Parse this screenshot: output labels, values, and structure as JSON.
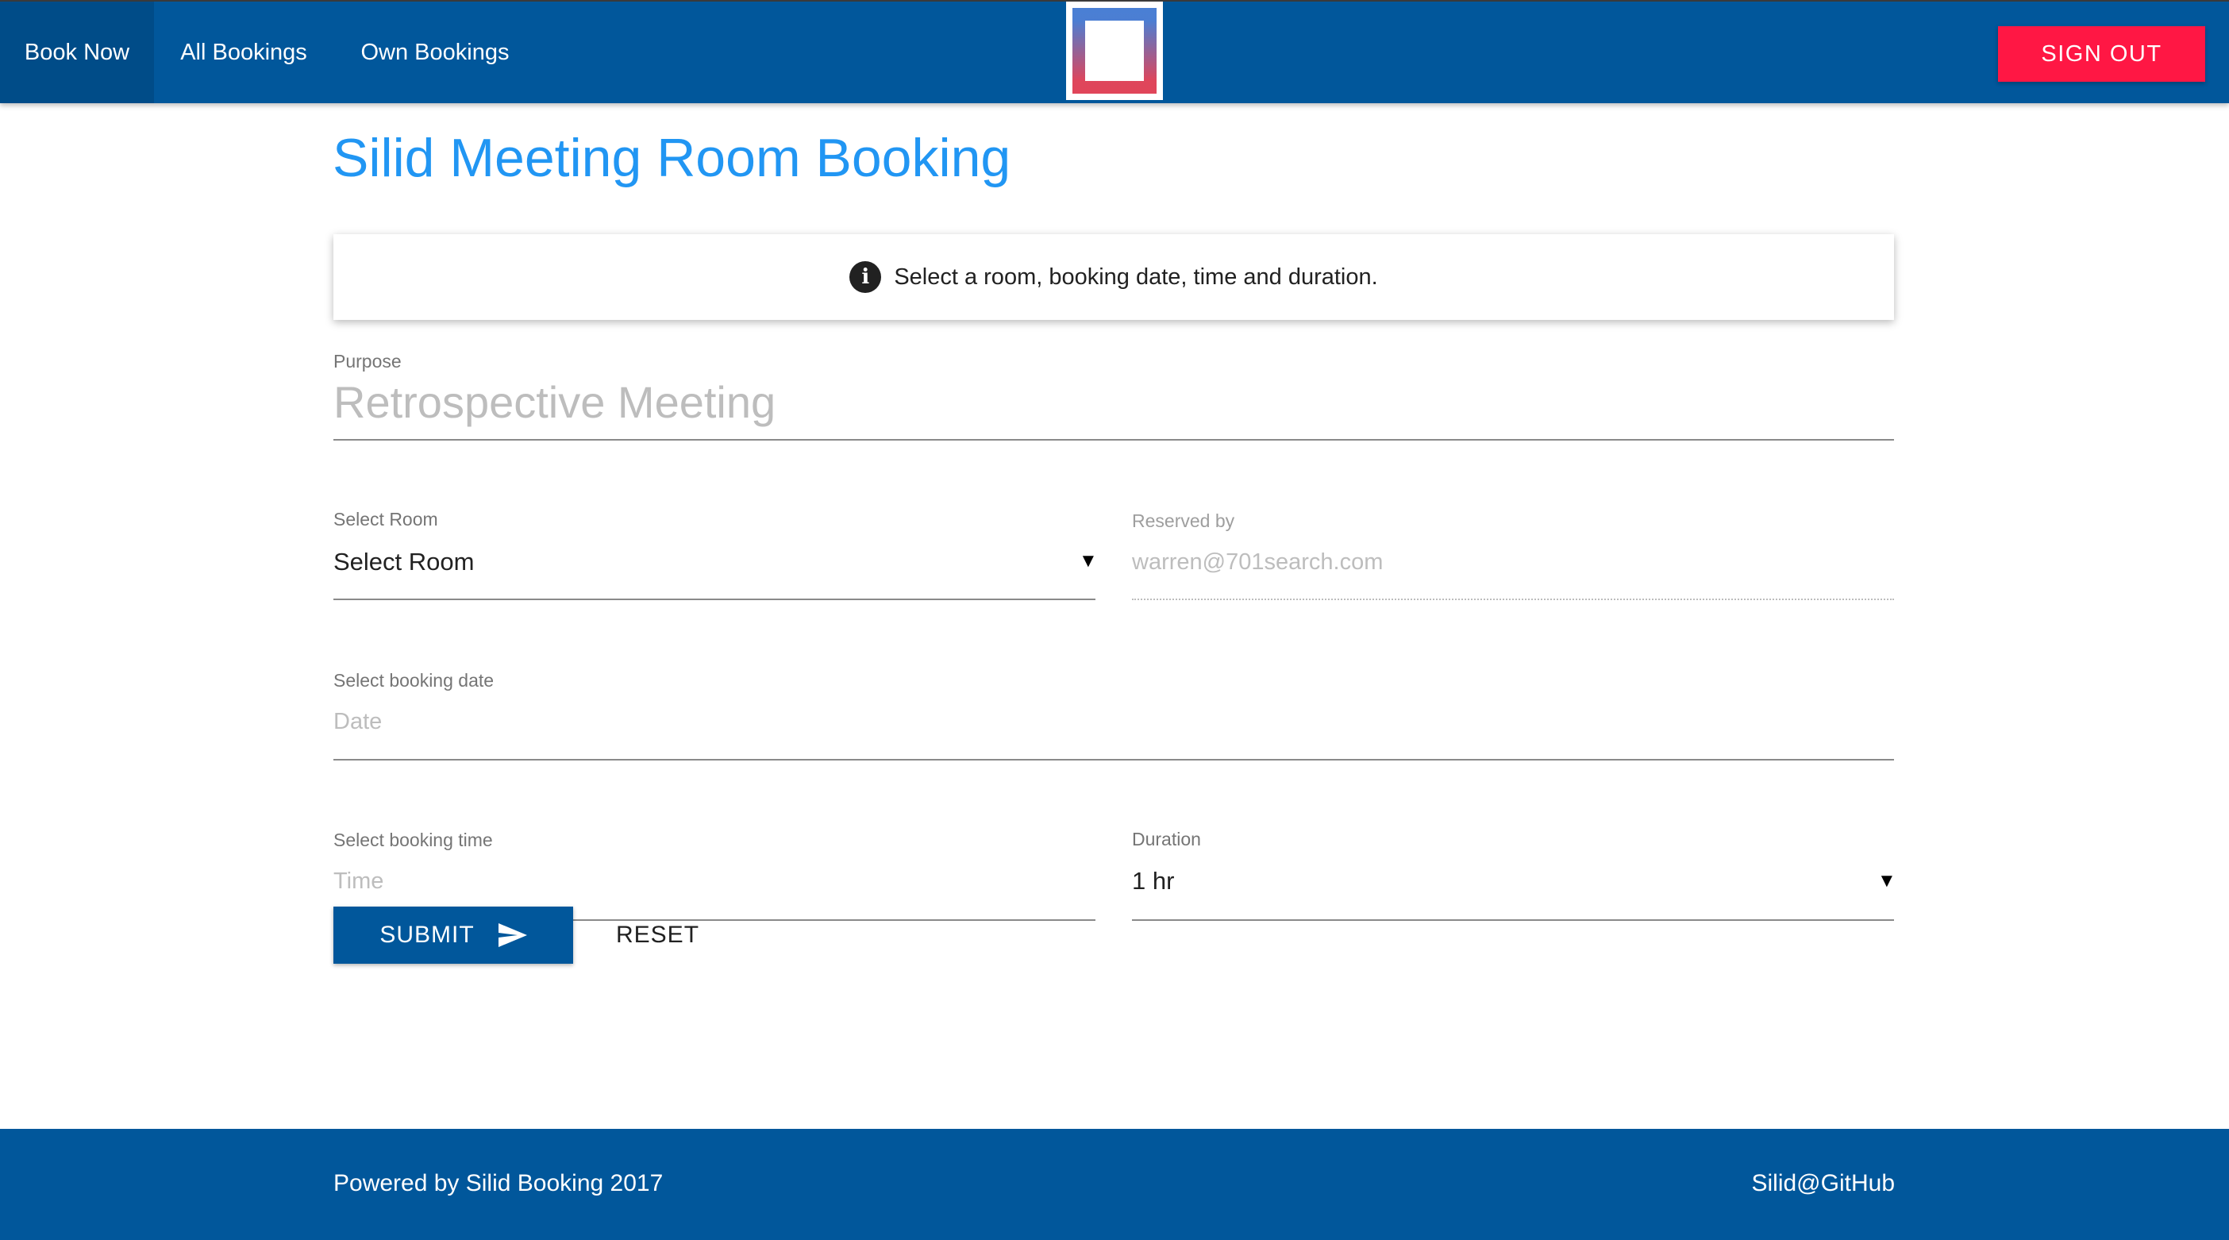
{
  "navbar": {
    "items": [
      {
        "label": "Book Now",
        "active": true
      },
      {
        "label": "All Bookings",
        "active": false
      },
      {
        "label": "Own Bookings",
        "active": false
      }
    ],
    "sign_out_label": "SIGN OUT"
  },
  "main": {
    "title": "Silid Meeting Room Booking",
    "info_message": "Select a room, booking date, time and duration.",
    "purpose": {
      "label": "Purpose",
      "placeholder": "Retrospective Meeting"
    },
    "room": {
      "label": "Select Room",
      "value": "Select Room"
    },
    "reserved_by": {
      "label": "Reserved by",
      "value": "warren@701search.com"
    },
    "date": {
      "label": "Select booking date",
      "placeholder": "Date"
    },
    "time": {
      "label": "Select booking time",
      "placeholder": "Time"
    },
    "duration": {
      "label": "Duration",
      "value": "1 hr"
    },
    "submit_label": "SUBMIT",
    "reset_label": "RESET"
  },
  "footer": {
    "left": "Powered by Silid Booking 2017",
    "right": "Silid@GitHub"
  },
  "colors": {
    "primary": "#01579b",
    "accent": "#ff1744",
    "title": "#2196f3"
  },
  "icons": {
    "info": "info-circle-icon",
    "submit": "send-icon",
    "dropdown": "caret-down-icon"
  }
}
